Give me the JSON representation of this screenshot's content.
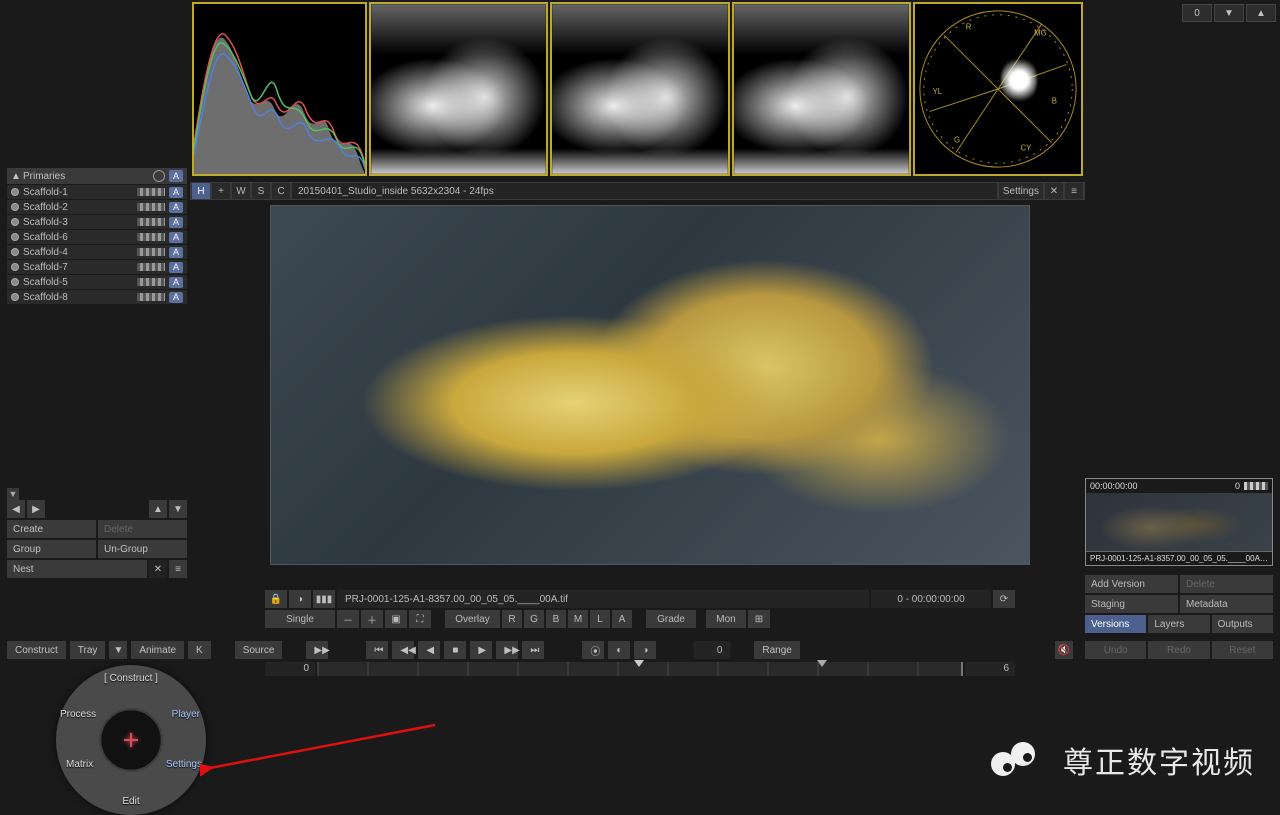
{
  "top": {
    "zero": "0"
  },
  "scaffold": {
    "header": "Primaries",
    "items": [
      {
        "name": "Scaffold-1"
      },
      {
        "name": "Scaffold-2"
      },
      {
        "name": "Scaffold-3"
      },
      {
        "name": "Scaffold-6"
      },
      {
        "name": "Scaffold-4"
      },
      {
        "name": "Scaffold-7"
      },
      {
        "name": "Scaffold-5"
      },
      {
        "name": "Scaffold-8"
      }
    ],
    "a_badge": "A",
    "create": "Create",
    "delete": "Delete",
    "group": "Group",
    "ungroup": "Un-Group",
    "nest": "Nest"
  },
  "infobar": {
    "h": "H",
    "plus": "+",
    "w": "W",
    "s": "S",
    "c": "C",
    "clip": "20150401_Studio_inside 5632x2304 - 24fps",
    "settings": "Settings"
  },
  "transport": {
    "filename": "PRJ-0001-125-A1-8357.00_00_05_05.____00A.tif",
    "timecode": "0 - 00:00:00:00",
    "single": "Single",
    "overlay": "Overlay",
    "r": "R",
    "g": "G",
    "b": "B",
    "m": "M",
    "l": "L",
    "a": "A",
    "grade": "Grade",
    "mon": "Mon"
  },
  "construct": {
    "construct": "Construct",
    "tray": "Tray",
    "animate": "Animate",
    "k": "K",
    "source": "Source",
    "frame": "0",
    "range": "Range",
    "tl_left": "0",
    "tl_right": "6"
  },
  "thumb": {
    "tc": "00:00:00:00",
    "name": "PRJ-0001-125-A1-8357.00_00_05_05.____00A.tif",
    "zero": "0"
  },
  "right": {
    "addversion": "Add Version",
    "delete": "Delete",
    "staging": "Staging",
    "metadata": "Metadata",
    "versions": "Versions",
    "layers": "Layers",
    "outputs": "Outputs",
    "undo": "Undo",
    "redo": "Redo",
    "reset": "Reset"
  },
  "radial": {
    "construct": "[ Construct ]",
    "process": "Process",
    "player": "Player",
    "matrix": "Matrix",
    "settings": "Settings",
    "edit": "Edit"
  },
  "watermark": "尊正数字视频",
  "vectorscope": {
    "r": "R",
    "g": "G",
    "b": "B",
    "cy": "CY",
    "mg": "MG",
    "yl": "YL"
  }
}
